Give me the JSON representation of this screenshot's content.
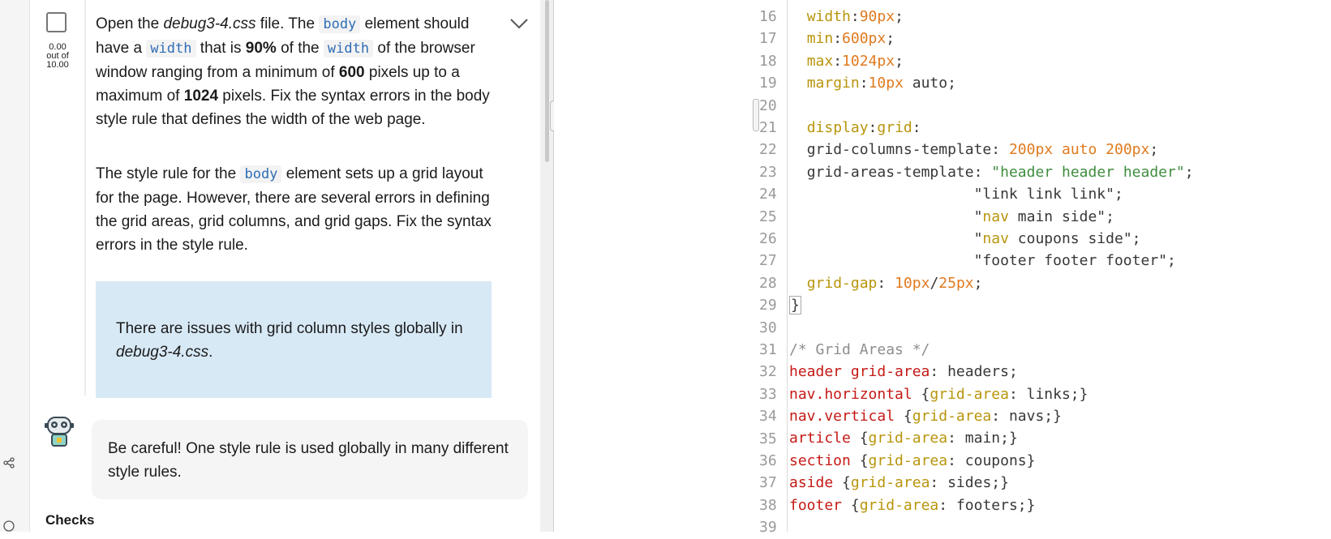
{
  "task": {
    "score_value": "0.00",
    "score_sep": "out of",
    "score_max": "10.00",
    "p1": {
      "a": "Open the ",
      "file": "debug3-4.css",
      "b": " file. The ",
      "code_body": "body",
      "c": " element should have a ",
      "code_width": "width",
      "d": " that is ",
      "pct": "90%",
      "e": " of the ",
      "code_width2": "width",
      "f": " of the browser window ranging from a minimum of ",
      "min": "600",
      "g": " pixels up to a maximum of ",
      "max": "1024",
      "h": " pixels. Fix the syntax errors in the body style rule that defines the width of the web page."
    },
    "p2": {
      "a": "The style rule for the ",
      "code_body": "body",
      "b": " element sets up a grid layout for the page. However, there are several errors in defining the grid areas, grid columns, and grid gaps. Fix the syntax errors in the style rule."
    },
    "hint": {
      "a": "There are issues with grid column styles globally in ",
      "file": "debug3-4.css",
      "b": "."
    },
    "tip": "Be careful! One style rule is used globally in many different style rules.",
    "checks_title": "Checks"
  },
  "editor": {
    "lines": [
      {
        "n": "16",
        "parts": [
          [
            "  ",
            ""
          ],
          [
            "width",
            ""
          ],
          [
            ":",
            ""
          ],
          [
            "90px",
            ""
          ],
          [
            ";",
            ""
          ]
        ]
      },
      {
        "n": "17"
      },
      {
        "n": "18"
      },
      {
        "n": "19"
      },
      {
        "n": "20"
      },
      {
        "n": "21"
      },
      {
        "n": "22"
      },
      {
        "n": "23"
      },
      {
        "n": "24"
      },
      {
        "n": "25"
      },
      {
        "n": "26"
      },
      {
        "n": "27"
      },
      {
        "n": "28"
      },
      {
        "n": "29"
      },
      {
        "n": "30"
      },
      {
        "n": "31"
      },
      {
        "n": "32"
      },
      {
        "n": "33"
      },
      {
        "n": "34"
      },
      {
        "n": "35"
      },
      {
        "n": "36"
      },
      {
        "n": "37"
      },
      {
        "n": "38"
      },
      {
        "n": "39"
      }
    ],
    "code": {
      "l16": [
        "width",
        ":",
        "90px",
        ";"
      ],
      "l17": [
        "min",
        ":",
        "600px",
        ";"
      ],
      "l18": [
        "max",
        ":",
        "1024px",
        ";"
      ],
      "l19": [
        "margin",
        ":",
        "10px",
        " auto;"
      ],
      "l21": [
        "display",
        ":",
        "grid",
        ":"
      ],
      "l22": [
        "grid-columns-template",
        ": ",
        "200px",
        " auto ",
        "200px",
        ";"
      ],
      "l23": [
        "grid-areas-template",
        ": ",
        "\"header header header\"",
        ";"
      ],
      "l24": "\"link link link\";",
      "l25": [
        "\"",
        "nav",
        " main side\";"
      ],
      "l26": [
        "\"",
        "nav",
        " coupons side\";"
      ],
      "l27": "\"footer footer footer\";",
      "l28": [
        "grid-gap",
        ": ",
        "10px",
        "/",
        "25px",
        ";"
      ],
      "l29": "}",
      "l31": "/* Grid Areas */",
      "l32": [
        "header ",
        "grid-area",
        ": headers;"
      ],
      "l33": [
        "nav.horizontal",
        " {",
        "grid-area",
        ": links;}"
      ],
      "l34": [
        "nav.vertical",
        " {",
        "grid-area",
        ": navs;}"
      ],
      "l35": [
        "article",
        " {",
        "grid-area",
        ": main;}"
      ],
      "l36": [
        "section",
        " {",
        "grid-area",
        ": coupons}"
      ],
      "l37": [
        "aside",
        " {",
        "grid-area",
        ": sides;}"
      ],
      "l38": [
        "footer",
        " {",
        "grid-area",
        ": footers;}"
      ]
    }
  },
  "colors": {
    "accent_code": "#2f6db5",
    "hint_bg": "#d8e9f6",
    "prop": "#b8950c",
    "number": "#e07a1f",
    "string": "#3f8d3f",
    "selector": "#c41a16"
  },
  "icons": {
    "share": "share-icon",
    "help": "help-icon",
    "chevron": "chevron-down-icon",
    "robot": "robot-avatar-icon"
  }
}
